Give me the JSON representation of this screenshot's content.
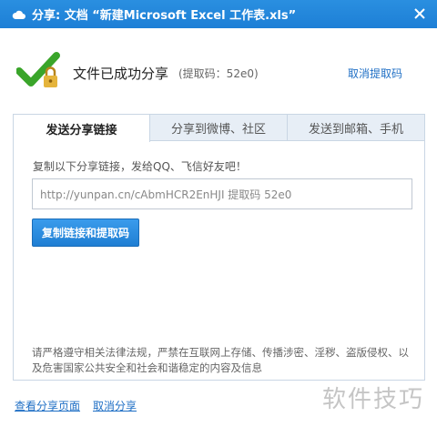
{
  "window": {
    "title": "分享: 文档 “新建Microsoft Excel 工作表.xls”",
    "logo_icon": "cloud-icon",
    "close_icon": "close-icon"
  },
  "success": {
    "icon": "check-lock-icon",
    "message": "文件已成功分享",
    "code_text": "(提取码：52e0)",
    "cancel_code_label": "取消提取码"
  },
  "tabs": [
    {
      "label": "发送分享链接",
      "active": true
    },
    {
      "label": "分享到微博、社区",
      "active": false
    },
    {
      "label": "发送到邮箱、手机",
      "active": false
    }
  ],
  "share": {
    "hint": "复制以下分享链接，发给QQ、飞信好友吧！",
    "link_value": "http://yunpan.cn/cAbmHCR2EnHJI  提取码 52e0",
    "copy_button_label": "复制链接和提取码",
    "notice": "请严格遵守相关法律法规，严禁在互联网上存储、传播涉密、淫秽、盗版侵权、以及危害国家公共安全和社会和谐稳定的内容及信息"
  },
  "footer": {
    "view_page_label": "查看分享页面",
    "cancel_share_label": "取消分享"
  },
  "watermark": "软件技巧",
  "colors": {
    "title_bar": "#1d7fd6",
    "link": "#1f6fc5",
    "check_green": "#3aa52a",
    "lock_gold": "#e5b43c"
  }
}
